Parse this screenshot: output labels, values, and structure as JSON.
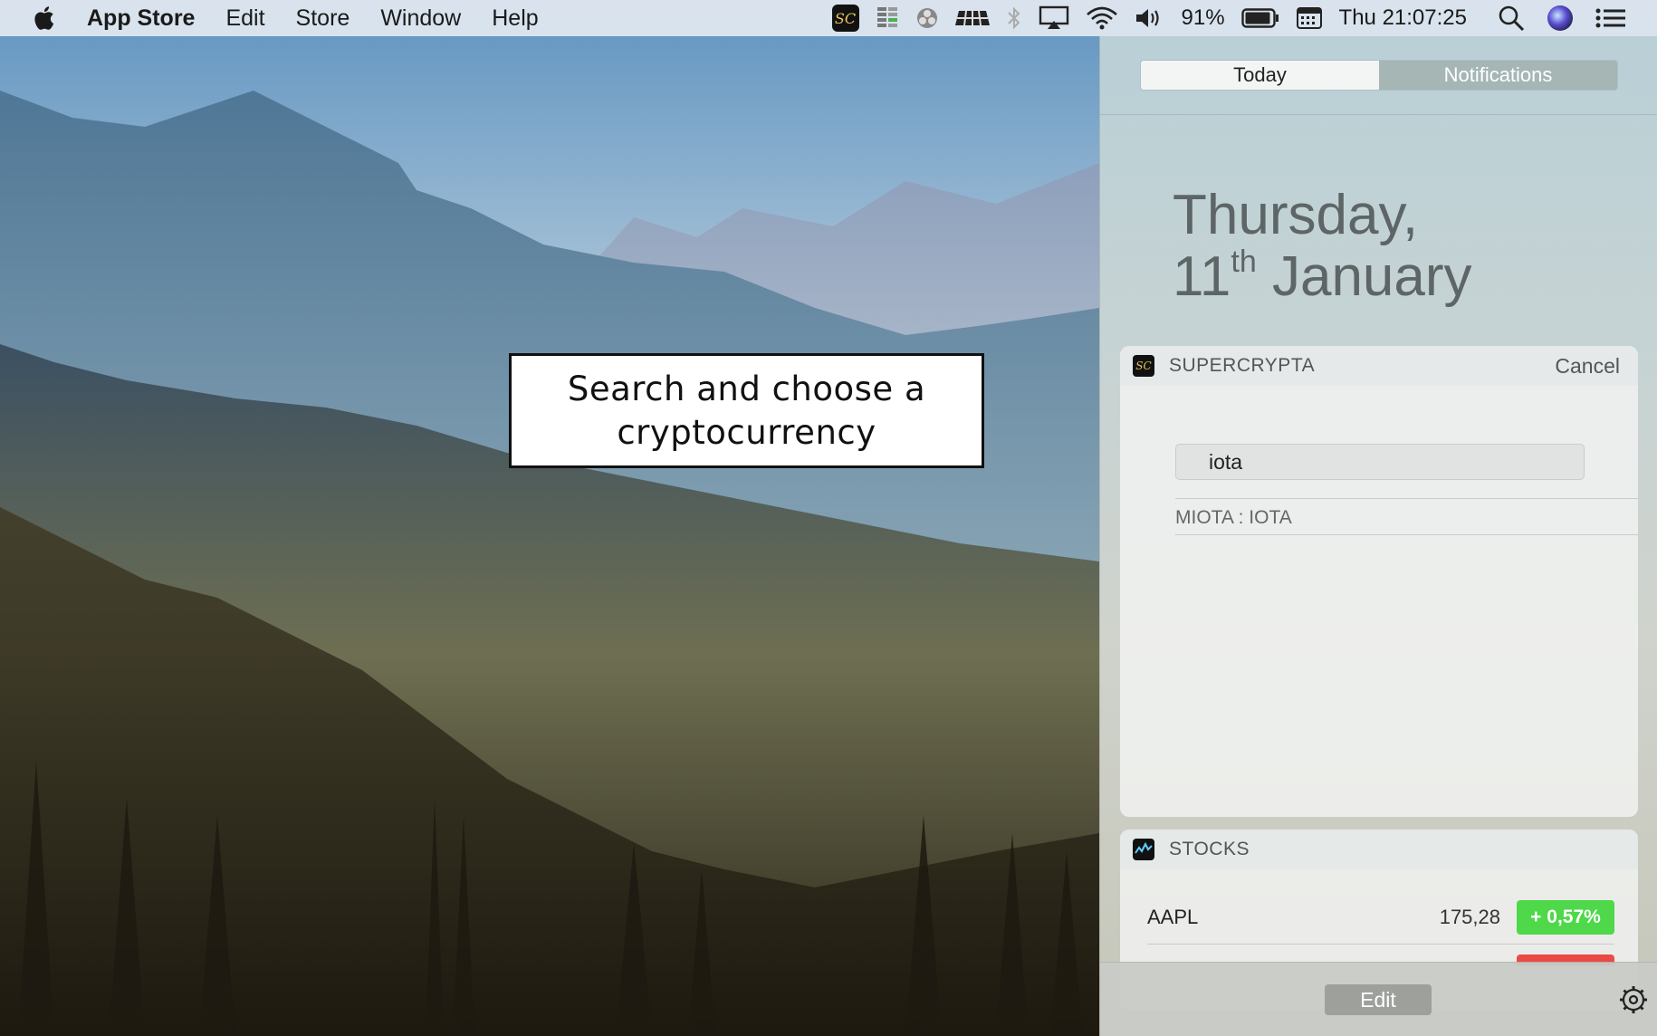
{
  "menubar": {
    "app_name": "App Store",
    "menus": [
      "Edit",
      "Store",
      "Window",
      "Help"
    ],
    "battery": "91%",
    "clock": "Thu 21:07:25",
    "status_icons": [
      "supercrypta-icon",
      "istat-icon",
      "color-wheel-icon",
      "ruler-icon",
      "bluetooth-icon",
      "airplay-icon",
      "wifi-icon",
      "volume-icon",
      "battery-icon",
      "calendar-icon",
      "spotlight-icon",
      "siri-icon",
      "notification-center-icon"
    ]
  },
  "callout": {
    "line1": "Search and choose a",
    "line2": "cryptocurrency"
  },
  "notification_center": {
    "tabs": [
      "Today",
      "Notifications"
    ],
    "active_tab": "Today",
    "date": {
      "weekday": "Thursday,",
      "day": "11",
      "suffix": "th",
      "month": "January"
    },
    "supercrypta": {
      "icon_text": "SC",
      "title": "SUPERCRYPTA",
      "cancel": "Cancel",
      "search_value": "iota",
      "results": [
        "MIOTA : IOTA"
      ]
    },
    "stocks": {
      "title": "STOCKS",
      "rows": [
        {
          "symbol": "AAPL",
          "price": "175,28",
          "change": "+ 0,57%",
          "change_color": "#4ed84a"
        }
      ],
      "next_change_color": "#ea4b44"
    },
    "footer": {
      "edit": "Edit"
    }
  }
}
